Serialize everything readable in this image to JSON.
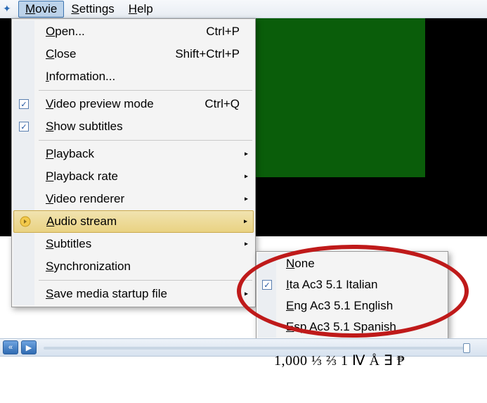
{
  "menubar": {
    "items": [
      {
        "label": "Movie",
        "accel_char": "M",
        "active": true
      },
      {
        "label": "Settings",
        "accel_char": "S",
        "active": false
      },
      {
        "label": "Help",
        "accel_char": "H",
        "active": false
      }
    ]
  },
  "menu": {
    "items": [
      {
        "type": "item",
        "label": "Open...",
        "ul": "O",
        "accel": "Ctrl+P"
      },
      {
        "type": "item",
        "label": "Close",
        "ul": "C",
        "accel": "Shift+Ctrl+P"
      },
      {
        "type": "item",
        "label": "Information...",
        "ul": "I"
      },
      {
        "type": "sep"
      },
      {
        "type": "item",
        "label": "Video preview mode",
        "ul": "V",
        "accel": "Ctrl+Q",
        "checked": true
      },
      {
        "type": "item",
        "label": "Show subtitles",
        "ul": "S",
        "checked": true
      },
      {
        "type": "sep"
      },
      {
        "type": "item",
        "label": "Playback",
        "ul": "P",
        "submenu": true
      },
      {
        "type": "item",
        "label": "Playback rate",
        "ul": "P",
        "submenu": true
      },
      {
        "type": "item",
        "label": "Video renderer",
        "ul": "V",
        "submenu": true
      },
      {
        "type": "item",
        "label": "Audio stream",
        "ul": "A",
        "submenu": true,
        "highlight": true,
        "icon": "audio"
      },
      {
        "type": "item",
        "label": "Subtitles",
        "ul": "S",
        "submenu": true
      },
      {
        "type": "item",
        "label": "Synchronization",
        "ul": "S"
      },
      {
        "type": "sep"
      },
      {
        "type": "item",
        "label": "Save media startup file",
        "ul": "S",
        "submenu": true
      }
    ]
  },
  "submenu_audio": {
    "items": [
      {
        "label": "None",
        "ul": "N"
      },
      {
        "label": "Ita Ac3 5.1 Italian",
        "ul": "I",
        "checked": true
      },
      {
        "label": "Eng Ac3 5.1 English",
        "ul": "E"
      },
      {
        "label": "Esp Ac3 5.1 Spanish",
        "ul": "E"
      }
    ]
  },
  "bottom_text": "1,000  ⅓ ⅔ 1 Ⅳ Å ∃ ₱"
}
